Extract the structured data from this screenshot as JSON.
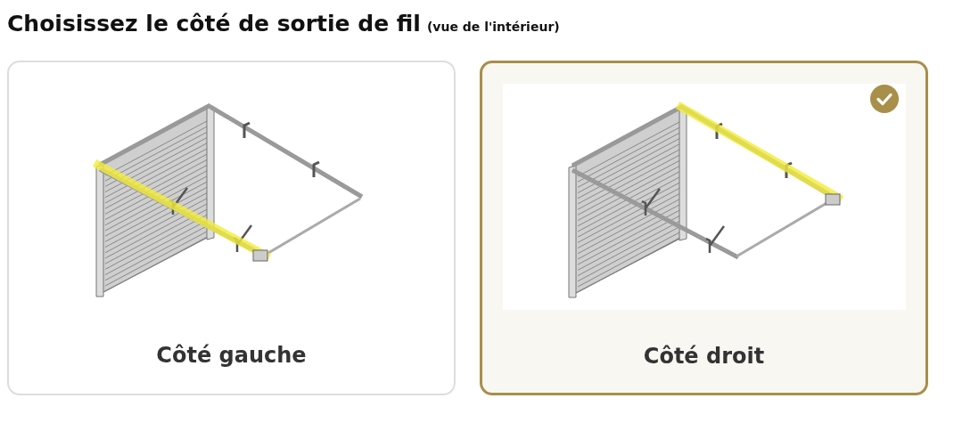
{
  "heading": {
    "title": "Choisissez le côté de sortie de fil",
    "note": "(vue de l'intérieur)"
  },
  "options": [
    {
      "label": "Côté gauche",
      "kind": "left",
      "selected": false
    },
    {
      "label": "Côté droit",
      "kind": "right",
      "selected": true
    }
  ]
}
